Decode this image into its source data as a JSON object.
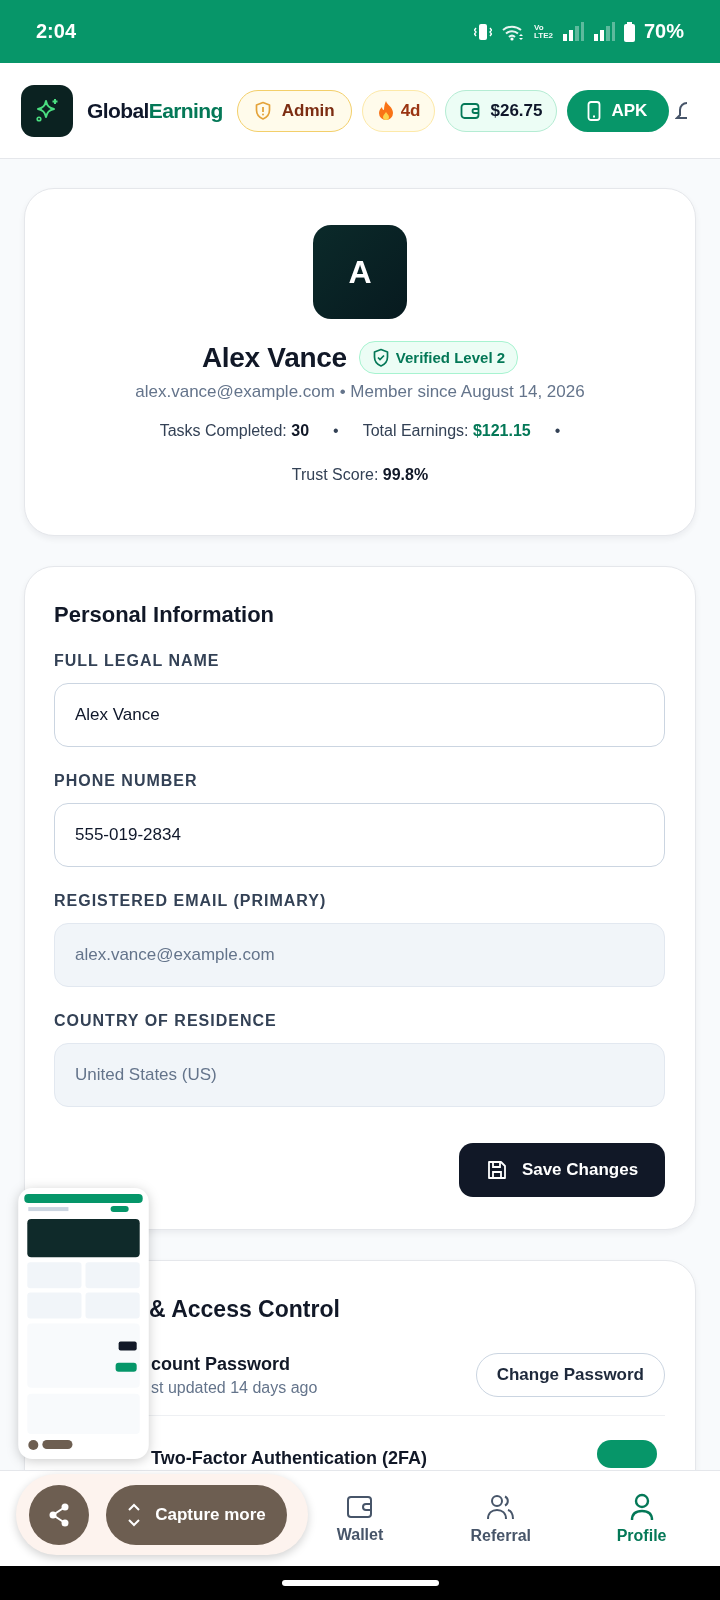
{
  "status_bar": {
    "time": "2:04",
    "network_label": [
      "Vo",
      "LTE2"
    ],
    "battery": "70%"
  },
  "header": {
    "brand": [
      "Global",
      "Earning"
    ],
    "chips": [
      {
        "kind": "role",
        "label": "Admin"
      },
      {
        "kind": "streak",
        "label": "4d"
      },
      {
        "kind": "wallet",
        "label": "$26.75"
      },
      {
        "kind": "apk",
        "label": "APK"
      }
    ]
  },
  "profile": {
    "initial": "A",
    "name": "Alex Vance",
    "badge": "Verified Level 2",
    "meta": "alex.vance@example.com • Member since August 14, 2026",
    "stats": [
      {
        "kind": "stat",
        "label": "Tasks Completed:",
        "value": "30",
        "highlight": false
      },
      {
        "kind": "dot",
        "label": "•"
      },
      {
        "kind": "stat",
        "label": "Total Earnings:",
        "value": "$121.15",
        "highlight": true
      },
      {
        "kind": "dot",
        "label": "•"
      },
      {
        "kind": "stat",
        "label": "Trust Score:",
        "value": "99.8%",
        "highlight": false
      }
    ]
  },
  "personal_information": {
    "title": "Personal Information",
    "fields": [
      {
        "label": "FULL LEGAL NAME",
        "value": "Alex Vance",
        "disabled": false
      },
      {
        "label": "PHONE NUMBER",
        "value": "555-019-2834",
        "disabled": false
      },
      {
        "label": "REGISTERED EMAIL (PRIMARY)",
        "value": "alex.vance@example.com",
        "disabled": true
      },
      {
        "label": "COUNTRY OF RESIDENCE",
        "value": "United States (US)",
        "disabled": true
      }
    ],
    "save_button": "Save Changes"
  },
  "security": {
    "title": "& Access Control",
    "rows": [
      {
        "kind": "button",
        "title": "count Password",
        "subtitle": "st updated 14 days ago",
        "action": "Change Password"
      },
      {
        "kind": "toggle",
        "title": "Two-Factor Authentication (2FA)",
        "on": true
      }
    ]
  },
  "bottom_nav": [
    {
      "kind": "wallet",
      "label": "Wallet",
      "selected": false
    },
    {
      "kind": "referral",
      "label": "Referral",
      "selected": false
    },
    {
      "kind": "profile",
      "label": "Profile",
      "selected": true
    }
  ],
  "capture_toolbar": {
    "capture_more": "Capture more"
  }
}
